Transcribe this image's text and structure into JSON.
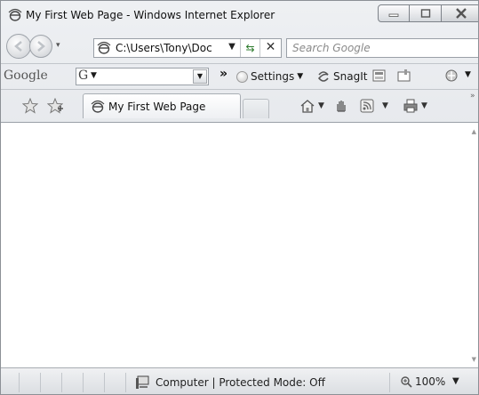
{
  "window": {
    "title": "My First Web Page - Windows Internet Explorer"
  },
  "address_bar": {
    "url": "C:\\Users\\Tony\\Doc",
    "search_placeholder": "Search Google"
  },
  "google_toolbar": {
    "logo": "Google",
    "search_prefix": "G",
    "overflow_glyph": "»",
    "settings_label": "Settings",
    "snagit_label": "SnagIt"
  },
  "tabs": [
    {
      "label": "My First Web Page"
    }
  ],
  "statusbar": {
    "zone": "Computer | Protected Mode: Off",
    "zoom": "100%"
  }
}
